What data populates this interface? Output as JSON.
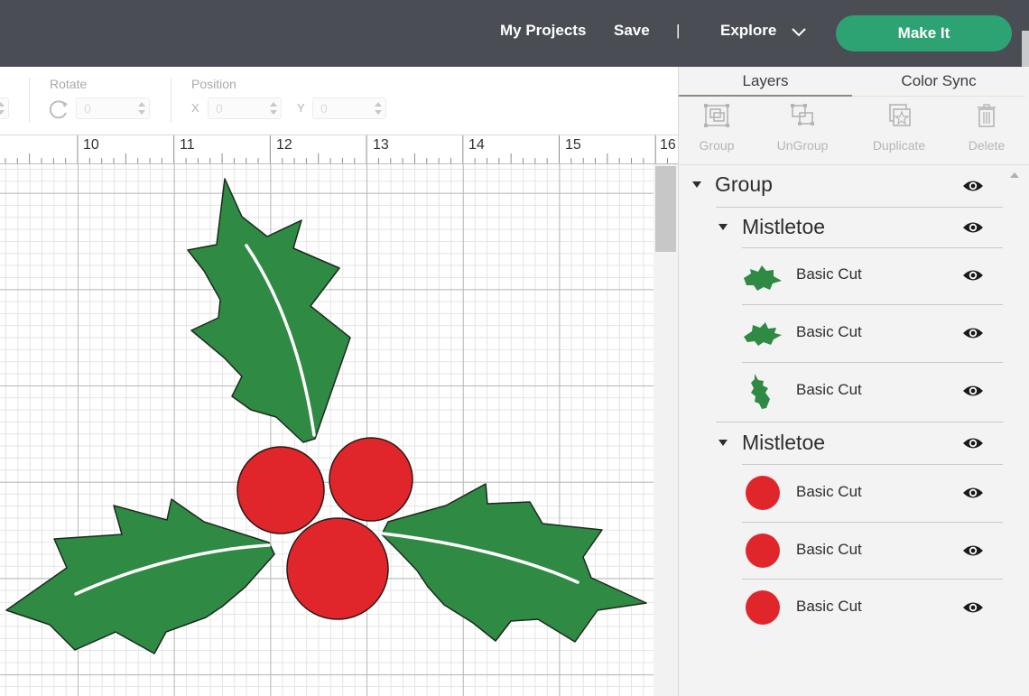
{
  "header": {
    "my_projects": "My Projects",
    "save": "Save",
    "separator": "|",
    "explore": "Explore",
    "make_it": "Make It"
  },
  "toolbar": {
    "rotate_label": "Rotate",
    "rotate_value": "0",
    "position_label": "Position",
    "x_label": "X",
    "x_value": "0",
    "y_label": "Y",
    "y_value": "0"
  },
  "ruler": {
    "ticks": [
      "10",
      "11",
      "12",
      "13",
      "14",
      "15",
      "16"
    ]
  },
  "panel": {
    "tabs": [
      {
        "label": "Layers",
        "active": true
      },
      {
        "label": "Color Sync",
        "active": false
      }
    ],
    "actions": [
      {
        "label": "Group",
        "icon": "group-icon"
      },
      {
        "label": "UnGroup",
        "icon": "ungroup-icon"
      },
      {
        "label": "Duplicate",
        "icon": "duplicate-icon"
      },
      {
        "label": "Delete",
        "icon": "trash-icon"
      }
    ],
    "tree": {
      "group_label": "Group",
      "subgroups": [
        {
          "label": "Mistletoe",
          "layers": [
            {
              "label": "Basic Cut",
              "thumb": "holly-leaf-left"
            },
            {
              "label": "Basic Cut",
              "thumb": "holly-leaf-right"
            },
            {
              "label": "Basic Cut",
              "thumb": "holly-leaf-top"
            }
          ]
        },
        {
          "label": "Mistletoe",
          "layers": [
            {
              "label": "Basic Cut",
              "thumb": "red-berry"
            },
            {
              "label": "Basic Cut",
              "thumb": "red-berry"
            },
            {
              "label": "Basic Cut",
              "thumb": "red-berry"
            }
          ]
        }
      ]
    }
  },
  "colors": {
    "topbar": "#4a4d54",
    "make_it": "#2da374",
    "leaf_green": "#2f8a44",
    "berry_red": "#e0262b"
  }
}
